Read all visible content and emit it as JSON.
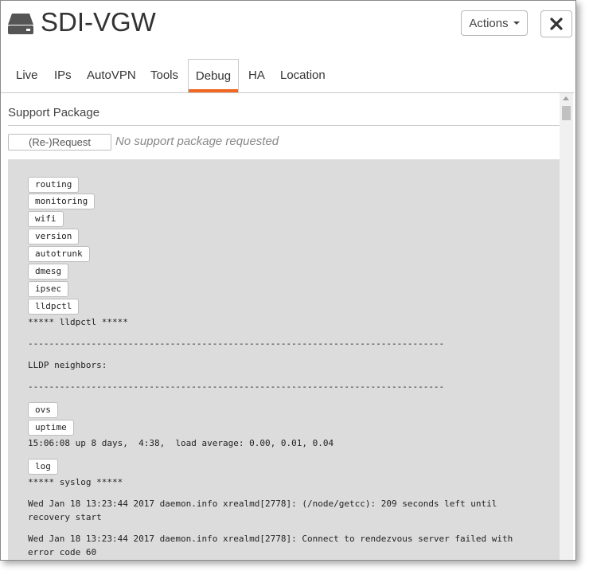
{
  "window": {
    "title": "SDI-VGW",
    "actions_label": "Actions",
    "icons": {
      "device": "device-icon",
      "close": "close-icon",
      "caret": "caret-down-icon"
    }
  },
  "tabs": [
    {
      "label": "Live"
    },
    {
      "label": "IPs"
    },
    {
      "label": "AutoVPN"
    },
    {
      "label": "Tools"
    },
    {
      "label": "Debug",
      "active": true
    },
    {
      "label": "HA"
    },
    {
      "label": "Location"
    }
  ],
  "support": {
    "title": "Support Package",
    "request_label": "(Re-)Request",
    "status": "No support package requested"
  },
  "debug": {
    "commands": {
      "routing": "routing",
      "monitoring": "monitoring",
      "wifi": "wifi",
      "version": "version",
      "autotrunk": "autotrunk",
      "dmesg": "dmesg",
      "ipsec": "ipsec",
      "lldpctl": "lldpctl",
      "ovs": "ovs",
      "uptime": "uptime",
      "log": "log"
    },
    "lldp_header": "***** lldpctl *****",
    "rule": "-------------------------------------------------------------------------------",
    "lldp_neighbors": "LLDP neighbors:",
    "uptime_output": "15:06:08 up 8 days,  4:38,  load average: 0.00, 0.01, 0.04",
    "syslog_header": "***** syslog *****",
    "log_line_1": "Wed Jan 18 13:23:44 2017 daemon.info xrealmd[2778]: (/node/getcc): 209 seconds left until\nrecovery start",
    "log_line_2": "Wed Jan 18 13:23:44 2017 daemon.info xrealmd[2778]: Connect to rendezvous server failed with\nerror code 60"
  },
  "colors": {
    "accent": "#f26722",
    "panel_bg": "#dcdcdc"
  }
}
